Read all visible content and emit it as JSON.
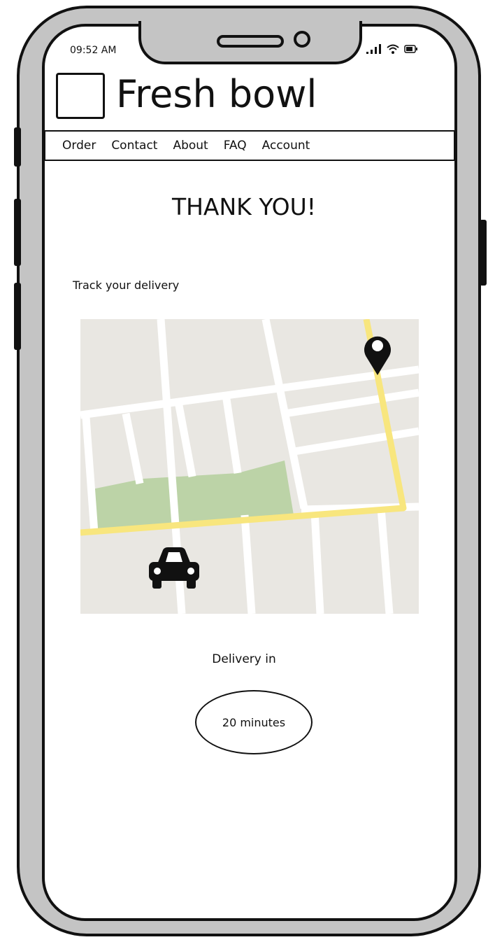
{
  "status_bar": {
    "time": "09:52 AM",
    "icons": [
      "signal-icon",
      "wifi-icon",
      "battery-icon"
    ]
  },
  "header": {
    "title": "Fresh bowl",
    "logo": "logo-placeholder"
  },
  "nav": {
    "items": [
      "Order",
      "Contact",
      "About",
      "FAQ",
      "Account"
    ]
  },
  "main": {
    "heading": "THANK YOU!",
    "track_label": "Track your delivery",
    "map": {
      "icons": [
        "location-pin-icon",
        "car-icon"
      ],
      "colors": {
        "background": "#e9e7e2",
        "roads": "#ffffff",
        "route": "#f8e67e",
        "park": "#bcd3a7"
      }
    },
    "delivery_label": "Delivery in",
    "eta": "20 minutes"
  }
}
